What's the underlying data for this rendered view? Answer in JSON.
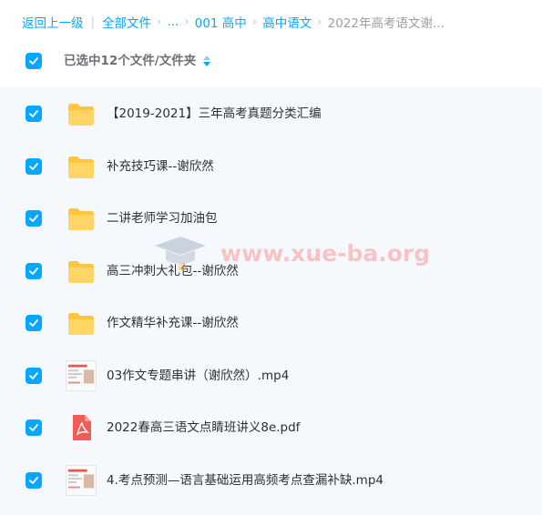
{
  "breadcrumb": {
    "back": "返回上一级",
    "all_files": "全部文件",
    "ellipsis": "...",
    "level1": "001 高中",
    "level2": "高中语文",
    "current": "2022年高考语文谢..."
  },
  "selection": {
    "label": "已选中12个文件/文件夹"
  },
  "files": [
    {
      "name": "【2019-2021】三年高考真题分类汇编",
      "type": "folder"
    },
    {
      "name": "补充技巧课--谢欣然",
      "type": "folder"
    },
    {
      "name": "二讲老师学习加油包",
      "type": "folder"
    },
    {
      "name": "高三冲刺大礼包--谢欣然",
      "type": "folder"
    },
    {
      "name": "作文精华补充课--谢欣然",
      "type": "folder"
    },
    {
      "name": "03作文专题串讲（谢欣然）.mp4",
      "type": "video"
    },
    {
      "name": "2022春高三语文点睛班讲义8e.pdf",
      "type": "pdf"
    },
    {
      "name": "4.考点预测—语言基础运用高频考点查漏补缺.mp4",
      "type": "video"
    }
  ],
  "watermark": {
    "text": "www.xue-ba.org",
    "icon": "graduation-cap-icon"
  },
  "colors": {
    "accent": "#06a7ff",
    "folder": "#ffc53d",
    "pdf": "#f25c54",
    "list_bg": "#f5f9fd"
  }
}
